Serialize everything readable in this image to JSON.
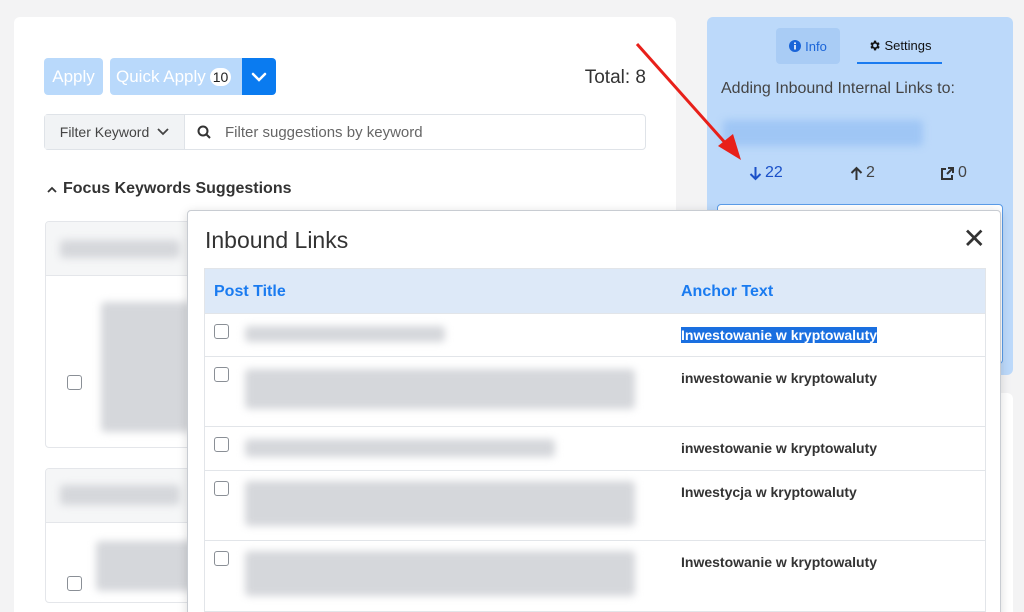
{
  "toolbar": {
    "apply_label": "Apply",
    "quick_apply_label": "Quick Apply",
    "quick_apply_count": "10",
    "total_label": "Total: 8"
  },
  "filter": {
    "keyword_label": "Filter Keyword",
    "search_placeholder": "Filter suggestions by keyword"
  },
  "focus_section": {
    "title": "Focus Keywords Suggestions"
  },
  "sidebar": {
    "tabs": [
      {
        "label": "Info",
        "icon": "info-icon"
      },
      {
        "label": "Settings",
        "icon": "gear-icon"
      }
    ],
    "adding_label": "Adding Inbound Internal Links to:",
    "stats": {
      "inbound": "22",
      "outbound": "2",
      "external": "0"
    }
  },
  "modal": {
    "title": "Inbound Links",
    "close_symbol": "✕",
    "columns": {
      "post_title": "Post Title",
      "anchor_text": "Anchor Text"
    },
    "rows": [
      {
        "anchor": "Inwestowanie w kryptowaluty"
      },
      {
        "anchor": "inwestowanie w kryptowaluty"
      },
      {
        "anchor": "inwestowanie w kryptowaluty"
      },
      {
        "anchor": "Inwestycja w kryptowaluty"
      },
      {
        "anchor": "Inwestowanie w kryptowaluty"
      }
    ]
  },
  "colors": {
    "accent": "#0a7bf0",
    "sidebar_bg": "#bcd9fa",
    "annotation_arrow": "#e8201a"
  }
}
